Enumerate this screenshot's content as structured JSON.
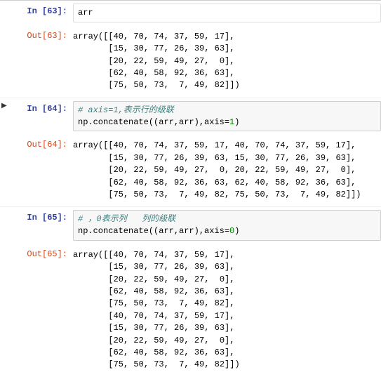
{
  "cells": [
    {
      "prompt_in": "In  [63]:",
      "input": "arr",
      "prompt_out": "Out[63]:",
      "output": "array([[40, 70, 74, 37, 59, 17],\n       [15, 30, 77, 26, 39, 63],\n       [20, 22, 59, 49, 27,  0],\n       [62, 40, 58, 92, 36, 63],\n       [75, 50, 73,  7, 49, 82]])"
    },
    {
      "prompt_in": "In  [64]:",
      "comment": "# axis=1,表示行的级联",
      "code": "np.concatenate((arr,arr),axis=",
      "axis": "1",
      "code_tail": ")",
      "prompt_out": "Out[64]:",
      "output": "array([[40, 70, 74, 37, 59, 17, 40, 70, 74, 37, 59, 17],\n       [15, 30, 77, 26, 39, 63, 15, 30, 77, 26, 39, 63],\n       [20, 22, 59, 49, 27,  0, 20, 22, 59, 49, 27,  0],\n       [62, 40, 58, 92, 36, 63, 62, 40, 58, 92, 36, 63],\n       [75, 50, 73,  7, 49, 82, 75, 50, 73,  7, 49, 82]])",
      "has_marker": true
    },
    {
      "prompt_in": "In  [65]:",
      "comment": "# ，0表示列   列的级联",
      "code": "np.concatenate((arr,arr),axis=",
      "axis": "0",
      "code_tail": ")",
      "prompt_out": "Out[65]:",
      "output": "array([[40, 70, 74, 37, 59, 17],\n       [15, 30, 77, 26, 39, 63],\n       [20, 22, 59, 49, 27,  0],\n       [62, 40, 58, 92, 36, 63],\n       [75, 50, 73,  7, 49, 82],\n       [40, 70, 74, 37, 59, 17],\n       [15, 30, 77, 26, 39, 63],\n       [20, 22, 59, 49, 27,  0],\n       [62, 40, 58, 92, 36, 63],\n       [75, 50, 73,  7, 49, 82]])"
    }
  ]
}
